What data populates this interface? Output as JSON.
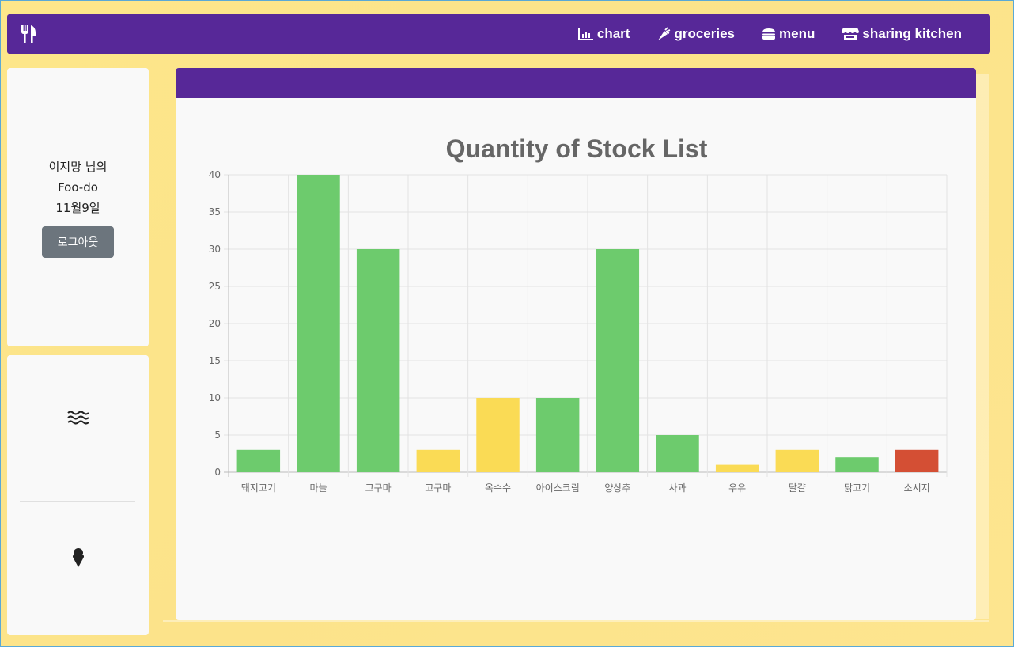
{
  "navbar": {
    "brand_icon": "utensils-icon",
    "links": [
      {
        "label": "chart",
        "icon": "chart-line-icon"
      },
      {
        "label": "groceries",
        "icon": "carrot-icon"
      },
      {
        "label": "menu",
        "icon": "hamburger-icon"
      },
      {
        "label": "sharing kitchen",
        "icon": "store-icon"
      }
    ],
    "color": "#572898"
  },
  "profile": {
    "line1": "이지망 님의",
    "line2": "Foo-do",
    "line3": "11월9일",
    "logout_label": "로그아웃"
  },
  "side_menu": {
    "items": [
      {
        "icon": "water-icon"
      },
      {
        "icon": "ice-cream-icon"
      }
    ]
  },
  "chart_data": {
    "type": "bar",
    "title": "Quantity of Stock List",
    "categories": [
      "돼지고기",
      "마늘",
      "고구마",
      "고구마",
      "옥수수",
      "아이스크림",
      "양상추",
      "사과",
      "우유",
      "달걀",
      "닭고기",
      "소시지"
    ],
    "values": [
      3,
      40,
      30,
      3,
      10,
      10,
      30,
      5,
      1,
      3,
      2,
      3
    ],
    "colors": [
      "#6dcb6d",
      "#6dcb6d",
      "#6dcb6d",
      "#fadb55",
      "#fadb55",
      "#6dcb6d",
      "#6dcb6d",
      "#6dcb6d",
      "#fadb55",
      "#fadb55",
      "#6dcb6d",
      "#d44f34"
    ],
    "ylim": [
      0,
      40
    ],
    "yticks": [
      0,
      5,
      10,
      15,
      20,
      25,
      30,
      35,
      40
    ],
    "grid": true,
    "xlabel": "",
    "ylabel": ""
  }
}
